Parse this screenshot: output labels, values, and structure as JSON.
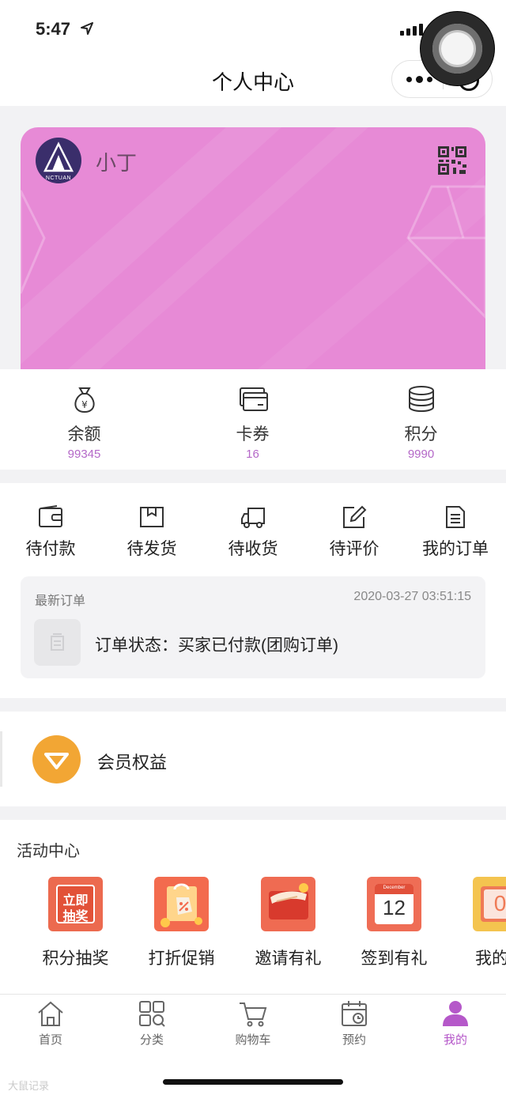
{
  "status_bar": {
    "time": "5:47"
  },
  "nav": {
    "title": "个人中心"
  },
  "card": {
    "user_name": "小丁",
    "avatar_text": "NCTUAN"
  },
  "assets": [
    {
      "label": "余额",
      "value": "99345",
      "icon": "money-bag-icon"
    },
    {
      "label": "卡券",
      "value": "16",
      "icon": "card-icon"
    },
    {
      "label": "积分",
      "value": "9990",
      "icon": "coins-icon"
    }
  ],
  "orders": {
    "items": [
      {
        "label": "待付款",
        "icon": "wallet-icon"
      },
      {
        "label": "待发货",
        "icon": "box-icon"
      },
      {
        "label": "待收货",
        "icon": "truck-icon"
      },
      {
        "label": "待评价",
        "icon": "edit-icon"
      },
      {
        "label": "我的订单",
        "icon": "list-icon"
      }
    ],
    "latest": {
      "title": "最新订单",
      "time": "2020-03-27 03:51:15",
      "status": "订单状态：买家已付款(团购订单)"
    }
  },
  "member": {
    "label": "会员权益"
  },
  "activity": {
    "title": "活动中心",
    "items": [
      {
        "label": "积分抽奖",
        "badge_line1": "立即",
        "badge_line2": "抽奖"
      },
      {
        "label": "打折促销"
      },
      {
        "label": "邀请有礼"
      },
      {
        "label": "签到有礼",
        "calendar_month": "December",
        "calendar_day": "12"
      },
      {
        "label": "我的团",
        "calendar_day": "0"
      }
    ]
  },
  "tabbar": [
    {
      "label": "首页",
      "icon": "home-icon"
    },
    {
      "label": "分类",
      "icon": "category-icon"
    },
    {
      "label": "购物车",
      "icon": "cart-icon"
    },
    {
      "label": "预约",
      "icon": "calendar-icon"
    },
    {
      "label": "我的",
      "icon": "user-icon",
      "active": true
    }
  ],
  "colors": {
    "card": "#e78ad6",
    "accent": "#b558c9",
    "member_badge": "#f2a634"
  },
  "watermark": "大鼠记录"
}
